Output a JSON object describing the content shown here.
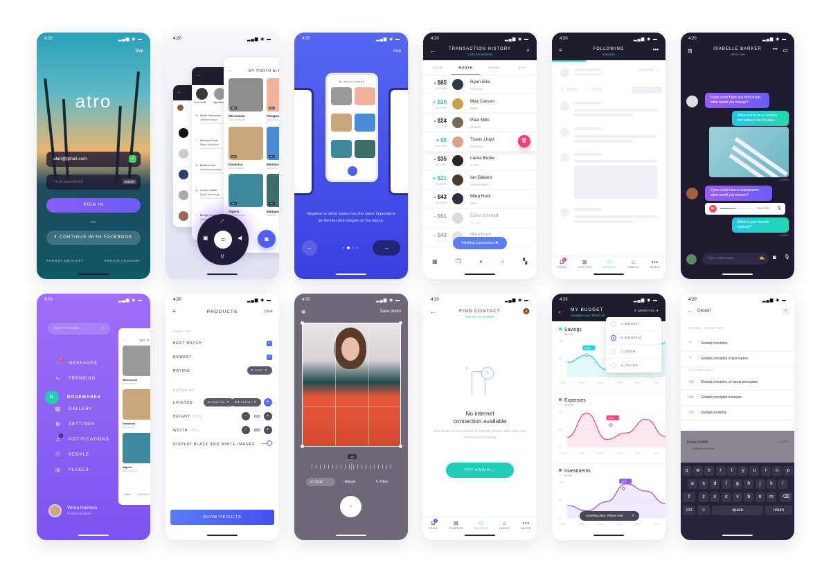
{
  "status_time": "4:20",
  "login": {
    "skip": "Skip",
    "logo": "atro",
    "email_value": "alan@gmail.com",
    "password_placeholder": "Your password",
    "show_label": "SHOW",
    "sign_in": "SIGN IN",
    "or": "OR",
    "facebook": "CONTINUE WITH FACEBOOK",
    "forgot": "FORGOT DETAILS?",
    "create": "CREATE ACCOUNT"
  },
  "albums_stack": {
    "title": "MY PHOTO ALBUMS",
    "albums": [
      {
        "name": "Micronesia",
        "place": "South Vellaville",
        "count": "581",
        "color": "#8e8e8e"
      },
      {
        "name": "Dominica",
        "place": "North Westley",
        "count": "202",
        "color": "#c9a77a"
      },
      {
        "name": "Paraguay",
        "place": "East Cecile",
        "count": "114",
        "color": "#f1b19a"
      },
      {
        "name": "Montserrat",
        "place": "Demarcus",
        "count": "291",
        "color": "#4a89d3"
      },
      {
        "name": "Madagascar",
        "place": "Volkman",
        "count": "635",
        "color": "#3f6e6a"
      },
      {
        "name": "Algeria",
        "place": "East Montserrat",
        "count": "581",
        "color": "#3d8a9c"
      }
    ],
    "contacts": [
      {
        "name": "Tom Castle",
        "role": "Verbum"
      },
      {
        "name": "Olga Sims",
        "role": "New Thad"
      }
    ],
    "messages": [
      {
        "name": "Mollie Stevenson",
        "subject": "Interface design",
        "dot": "#5170f0"
      },
      {
        "name": "Bernard Poole",
        "subject": "Rapid application",
        "dot": "#c8cbd8"
      },
      {
        "name": "Mattie Keller",
        "subject": "Architectural design",
        "dot": "#5170f0"
      },
      {
        "name": "Ernest Griffith",
        "subject": "Digital technology",
        "dot": "#f0407b"
      },
      {
        "name": "Madge Hunt",
        "subject": "Information architecture",
        "dot": "#c8cbd8"
      }
    ]
  },
  "onboarding": {
    "skip": "Skip",
    "text": "Negative or white space has the same importance as the text and images on the layout.",
    "phone_title": "MY PHOTO ALBUMS",
    "active_page": 2,
    "page_count": 4
  },
  "transactions": {
    "title": "TRANSACTION HISTORY",
    "subtitle": "1,243 transactions",
    "tabs": [
      "YEAR",
      "MONTH",
      "WEEK",
      "DAY"
    ],
    "active_tab": "MONTH",
    "rows": [
      {
        "amount": "- $85",
        "time": "06:34AM",
        "name": "Ryan Ellis",
        "type": "Payment",
        "positive": false,
        "avatar": "#2d3a4a"
      },
      {
        "amount": "+ $20",
        "time": "08:54PM",
        "name": "Max Carson",
        "type": "Debit",
        "positive": true,
        "avatar": "#c9a04a"
      },
      {
        "amount": "- $24",
        "time": "02:25PM",
        "name": "Paul Mills",
        "type": "Refund",
        "positive": false,
        "avatar": "#7a6a5a"
      },
      {
        "amount": "+ $6",
        "time": "09:13PM",
        "name": "Travis Lloyd",
        "type": "Payment",
        "positive": true,
        "avatar": "#d9a08a"
      },
      {
        "amount": "- $35",
        "time": "00:12AM",
        "name": "Laura Burke",
        "type": "Credit",
        "positive": false,
        "avatar": "#2a2422"
      },
      {
        "amount": "+ $21",
        "time": "05:40AM",
        "name": "Ian Ballard",
        "type": "Authorization",
        "positive": true,
        "avatar": "#4a3a30"
      },
      {
        "amount": "- $43",
        "time": "05:45PM",
        "name": "Mina Hunt",
        "type": "Sale",
        "positive": false,
        "avatar": "#2a3040"
      },
      {
        "amount": "- $51",
        "time": "00:28AM",
        "name": "Edna Schmidt",
        "type": "Refund",
        "positive": false,
        "avatar": "#b6b0a8"
      },
      {
        "amount": "- $43",
        "time": "05:45PM",
        "name": "Mina Hunt",
        "type": "Sale",
        "positive": false,
        "avatar": "#c0c8b8"
      }
    ],
    "toast": "Fetching transactions"
  },
  "following": {
    "title": "FOLLOWING",
    "subtitle": "#seaside",
    "tabs": [
      {
        "label": "FEED",
        "icon": "feed-icon",
        "badge": "3"
      },
      {
        "label": "PHOTOS",
        "icon": "photos-icon"
      },
      {
        "label": "PEOPLE",
        "icon": "people-icon",
        "active": true
      },
      {
        "label": "INBOX",
        "icon": "inbox-icon"
      },
      {
        "label": "MORE",
        "icon": "more-icon"
      }
    ]
  },
  "chat": {
    "title": "ISABELLE BARKER",
    "subtitle": "online now",
    "messages": [
      {
        "text": "If you could have any kind of pet, what would you choose?",
        "side": "left"
      },
      {
        "text": "Strive not to be a success, but rather to be of value.",
        "side": "right"
      },
      {
        "text": "If you could have a superpower, what would you choose?",
        "side": "left"
      },
      {
        "text": "What is your favorite comedy?",
        "side": "right"
      }
    ],
    "time1": "10:55PM",
    "time2": "10:55PM",
    "audio_time": "00:34 / 1:12",
    "input_placeholder": "Type a message..."
  },
  "menu": {
    "search_placeholder": "Type a message...",
    "items": [
      {
        "label": "MESSAGES",
        "icon": "chat-bubble-icon",
        "badge": "3"
      },
      {
        "label": "TRENDING",
        "icon": "activity-icon"
      },
      {
        "label": "BOOKMARKS",
        "icon": "bookmark-icon",
        "active": true
      },
      {
        "label": "GALLERY",
        "icon": "image-icon"
      },
      {
        "label": "SETTINGS",
        "icon": "gear-icon"
      },
      {
        "label": "NOTIFICATIONS",
        "icon": "bell-icon",
        "badge": "6"
      },
      {
        "label": "PEOPLE",
        "icon": "people-icon"
      },
      {
        "label": "PLACES",
        "icon": "location-pin-icon"
      }
    ],
    "user_name": "Verna Harrison",
    "user_role": "Product Designer",
    "peek_title": "MY P",
    "peek_albums": [
      {
        "name": "Micronesia",
        "place": "South Vellaville"
      },
      {
        "name": "Dominica",
        "place": "North Westley"
      },
      {
        "name": "Algeria",
        "place": "East Montserrat"
      }
    ],
    "peek_tabs": [
      "FEED",
      "PHOTOS"
    ]
  },
  "products": {
    "title": "PRODUCTS",
    "clear": "Clear",
    "sort_by": "SORT BY",
    "best_match": "BEST MATCH",
    "best_match_checked": true,
    "newest": "NEWEST",
    "newest_checked": true,
    "rating": "RATING",
    "rating_chip": "5 star",
    "filter_by": "FILTER BY",
    "licence": "LICENCE",
    "licence_chips": [
      "Creative",
      "Editorial"
    ],
    "height": "HEIGHT",
    "height_unit": "(PX)",
    "height_value": "600",
    "width": "WIDTH",
    "width_unit": "(PX)",
    "width_value": "800",
    "display_bw": "DISPLAY BLACK AND WHITE IMAGES",
    "display_bw_on": false,
    "show_results": "SHOW RESULTS"
  },
  "editor": {
    "save": "Save photo",
    "angle": "-30°",
    "tools": [
      {
        "label": "Crop",
        "icon": "crop-icon",
        "active": true
      },
      {
        "label": "Adjust",
        "icon": "sliders-icon"
      },
      {
        "label": "Filter",
        "icon": "feather-icon"
      }
    ]
  },
  "find_contact": {
    "title": "FIND CONTACT",
    "subtitle": "Network not available",
    "headline_1": "No internet",
    "headline_2": "connection available",
    "body": "Your device is not connect to internet, please make sure your connection is working.",
    "button": "TRY AGAIN...",
    "tabs": [
      {
        "label": "FEED",
        "icon": "feed-icon",
        "badge": "3"
      },
      {
        "label": "PHOTOS",
        "icon": "photos-icon"
      },
      {
        "label": "PEOPLE",
        "icon": "people-icon",
        "active": true
      },
      {
        "label": "INBOX",
        "icon": "inbox-icon"
      },
      {
        "label": "MORE",
        "icon": "more-icon"
      }
    ]
  },
  "budget": {
    "title": "MY BUDGET",
    "subtitle": "Available now: $3550.36",
    "period": "6 MONTHS",
    "period_options": [
      {
        "label": "1 MONTH",
        "selected": false
      },
      {
        "label": "6 MONTHS",
        "selected": true
      },
      {
        "label": "1 YEAR",
        "selected": false
      },
      {
        "label": "5 YEARS",
        "selected": false
      }
    ],
    "toast": "Updating data. Please wait"
  },
  "chart_data": [
    {
      "type": "area",
      "title": "Savings",
      "subtitle": "$52721",
      "color": "#22d3d8",
      "categories": [
        "JAN",
        "FEB",
        "MAR",
        "APR",
        "MAY",
        "JUN"
      ],
      "y_ticks": [
        0,
        50,
        100
      ],
      "ylim": [
        0,
        100
      ],
      "values": [
        40,
        60,
        20,
        35,
        30,
        95
      ],
      "annotation": {
        "label": "$139",
        "x": "FEB",
        "value": 60
      }
    },
    {
      "type": "area",
      "title": "Expenses",
      "subtitle": "$75948",
      "color": "#f0407b",
      "categories": [
        "JAN",
        "FEB",
        "MAR",
        "APR",
        "MAY",
        "JUN"
      ],
      "y_ticks": [
        0,
        50,
        100
      ],
      "ylim": [
        0,
        100
      ],
      "values": [
        28,
        95,
        22,
        40,
        78,
        30
      ],
      "annotation": {
        "label": "$287",
        "x": "MAR",
        "value": 62
      }
    },
    {
      "type": "area",
      "title": "Investments",
      "subtitle": "$8786",
      "color": "#8b55f0",
      "categories": [
        "JAN",
        "FEB",
        "MAR",
        "APR",
        "MAY",
        "JUN"
      ],
      "y_ticks": [
        0,
        50,
        100
      ],
      "ylim": [
        0,
        100
      ],
      "values": [
        35,
        20,
        45,
        95,
        75,
        40
      ],
      "annotation": {
        "label": "$810",
        "x": "APR",
        "value": 82
      }
    }
  ],
  "search": {
    "query": "Gestalt",
    "recent_label": "RECENT SEARCHES",
    "recent": [
      "Gestalt principles",
      "Gestalt principles of perception"
    ],
    "top_label": "TOP RESULTS",
    "top": [
      "Gestalt principles of visual perception",
      "Gestalt principles example",
      "Gestalt proximity"
    ],
    "behind_name": "Ernest Griffith",
    "behind_subject": "Digital technology",
    "behind_time": "11:32PM",
    "keyboard_rows": [
      [
        "q",
        "w",
        "e",
        "r",
        "t",
        "y",
        "u",
        "i",
        "o",
        "p"
      ],
      [
        "a",
        "s",
        "d",
        "f",
        "g",
        "h",
        "j",
        "k",
        "l"
      ],
      [
        "z",
        "x",
        "c",
        "v",
        "b",
        "n",
        "m"
      ]
    ],
    "key_123": "123",
    "key_space": "space",
    "key_return": "return"
  }
}
